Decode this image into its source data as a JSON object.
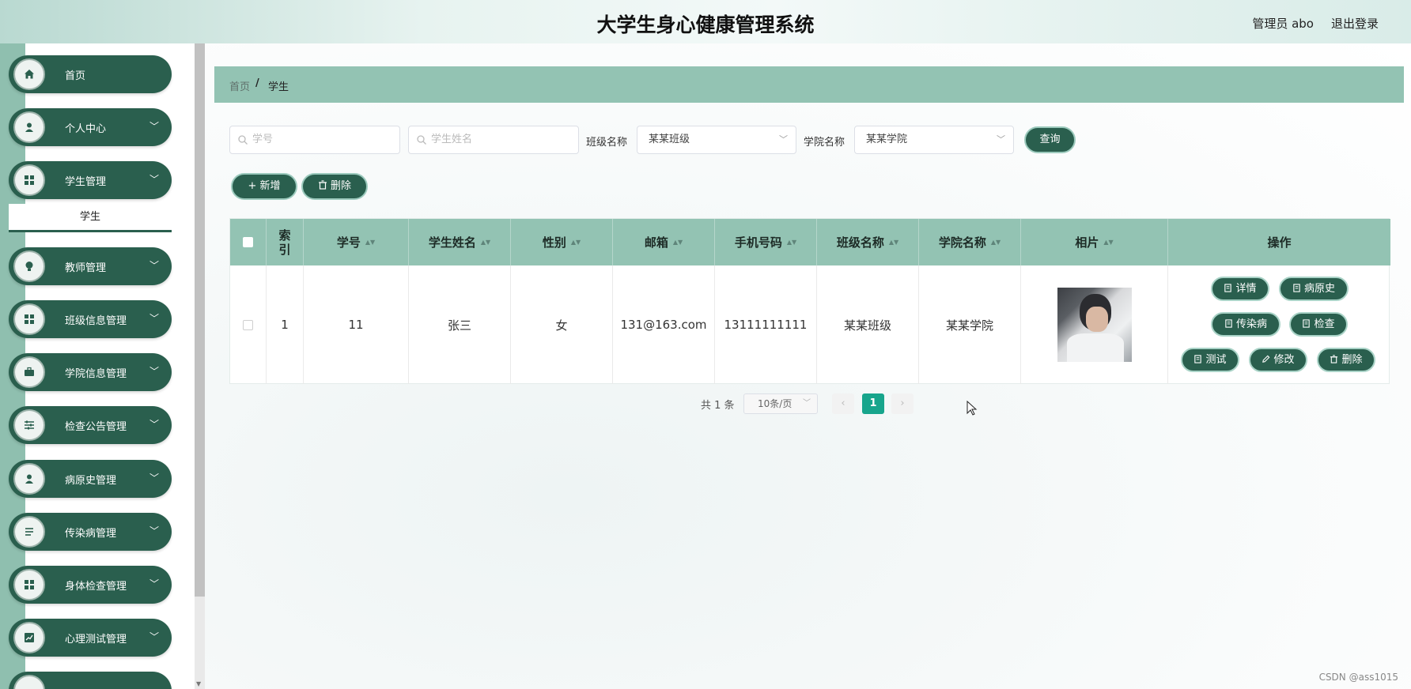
{
  "header": {
    "title": "大学生身心健康管理系统",
    "user": "管理员 abo",
    "logout": "退出登录"
  },
  "sidebar": {
    "items": [
      {
        "label": "首页",
        "icon": "home-icon",
        "has_arrow": false
      },
      {
        "label": "个人中心",
        "icon": "user-icon",
        "has_arrow": true
      },
      {
        "label": "学生管理",
        "icon": "grid-icon",
        "has_arrow": true
      },
      {
        "label": "教师管理",
        "icon": "bulb-icon",
        "has_arrow": true
      },
      {
        "label": "班级信息管理",
        "icon": "grid-icon",
        "has_arrow": true
      },
      {
        "label": "学院信息管理",
        "icon": "briefcase-icon",
        "has_arrow": true
      },
      {
        "label": "检查公告管理",
        "icon": "sliders-icon",
        "has_arrow": true
      },
      {
        "label": "病原史管理",
        "icon": "user-icon",
        "has_arrow": true
      },
      {
        "label": "传染病管理",
        "icon": "list-icon",
        "has_arrow": true
      },
      {
        "label": "身体检查管理",
        "icon": "grid-icon",
        "has_arrow": true
      },
      {
        "label": "心理测试管理",
        "icon": "chart-icon",
        "has_arrow": true
      }
    ],
    "submenu": "学生"
  },
  "breadcrumb": {
    "home": "首页",
    "separator": "/",
    "current": "学生"
  },
  "search": {
    "student_no_placeholder": "学号",
    "student_name_placeholder": "学生姓名",
    "class_label": "班级名称",
    "class_value": "某某班级",
    "college_label": "学院名称",
    "college_value": "某某学院",
    "query_button": "查询"
  },
  "actions": {
    "add": "新增",
    "delete": "删除"
  },
  "table": {
    "columns": [
      "索引",
      "学号",
      "学生姓名",
      "性别",
      "邮箱",
      "手机号码",
      "班级名称",
      "学院名称",
      "相片",
      "操作"
    ],
    "rows": [
      {
        "index": "1",
        "student_no": "11",
        "name": "张三",
        "gender": "女",
        "email": "131@163.com",
        "phone": "13111111111",
        "class": "某某班级",
        "college": "某某学院"
      }
    ],
    "row_ops": {
      "detail": "详情",
      "history": "病原史",
      "infection": "传染病",
      "check": "检查",
      "test": "测试",
      "edit": "修改",
      "delete": "删除"
    }
  },
  "pagination": {
    "total": "共 1 条",
    "page_size": "10条/页",
    "prev": "‹",
    "current": "1",
    "next": "›"
  },
  "watermark": "CSDN @ass1015",
  "colors": {
    "primary": "#2a5f4e",
    "header_row": "#93c3b3",
    "active_page": "#17a58c"
  }
}
